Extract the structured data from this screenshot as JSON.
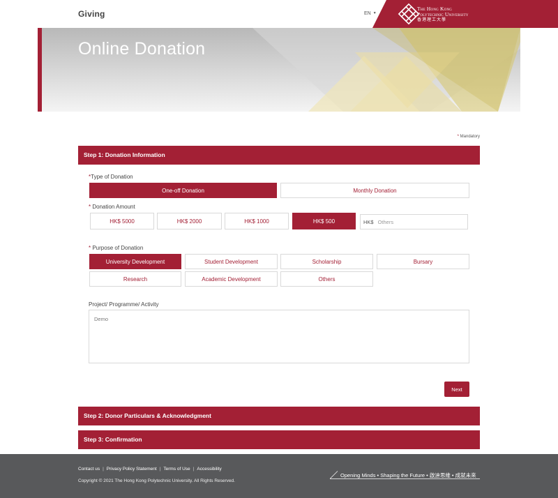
{
  "header": {
    "brand": "Giving",
    "language": "EN",
    "logo_line1": "The Hong Kong",
    "logo_line2": "Polytechnic University",
    "logo_line3": "香港理工大學"
  },
  "banner": {
    "title": "Online Donation"
  },
  "form": {
    "mandatory_note": "Mandatory",
    "step1_title": "Step 1: Donation Information",
    "type_label": "Type of Donation",
    "type_options": [
      "One-off Donation",
      "Monthly Donation"
    ],
    "type_selected": "One-off Donation",
    "amount_label": "Donation Amount",
    "amount_options": [
      "HK$ 5000",
      "HK$ 2000",
      "HK$ 1000",
      "HK$ 500"
    ],
    "amount_selected": "HK$ 500",
    "other_currency": "HK$",
    "other_placeholder": "Others",
    "purpose_label": "Purpose of Donation",
    "purpose_options": [
      "University Development",
      "Student Development",
      "Scholarship",
      "Bursary",
      "Research",
      "Academic Development",
      "Others"
    ],
    "purpose_selected": "University Development",
    "project_label": "Project/ Programme/ Activity",
    "project_value": "Demo",
    "next_label": "Next",
    "step2_title": "Step 2: Donor Particulars & Acknowledgment",
    "step3_title": "Step 3: Confirmation"
  },
  "footer": {
    "links": [
      "Contact us",
      "Privacy Policy Statement",
      "Terms of Use",
      "Accessibility"
    ],
    "copyright": "Copyright © 2021 The Hong Kong Polytechnic University. All Rights Reserved.",
    "slogan": "Opening Minds • Shaping the Future • 啟迪思維 • 成就未來"
  },
  "colors": {
    "brand": "#a32035",
    "footer_bg": "#58595b",
    "border": "#d9d9d9"
  },
  "icons": {
    "language_caret": "caret-down-icon",
    "logo": "polyu-lattice-logo-icon"
  }
}
